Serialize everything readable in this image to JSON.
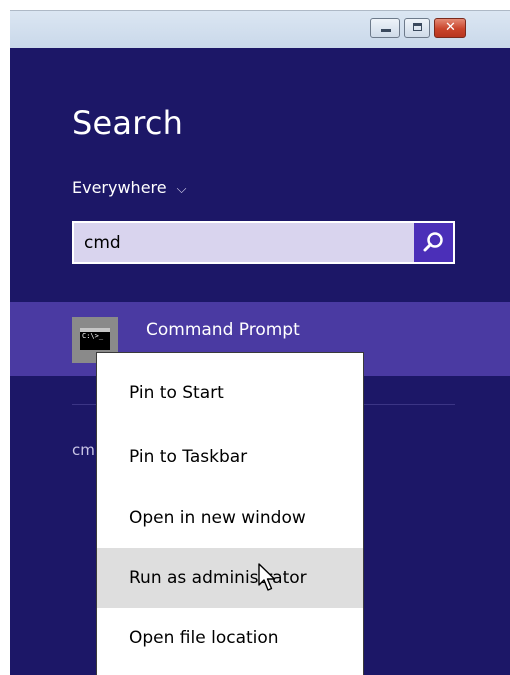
{
  "window": {
    "controls": [
      {
        "name": "minimize-icon"
      },
      {
        "name": "maximize-icon"
      },
      {
        "name": "close-icon",
        "glyph": "✕"
      }
    ]
  },
  "search_panel": {
    "title": "Search",
    "scope": {
      "label": "Everywhere",
      "chevron": "⌵"
    },
    "search_box": {
      "value": "cmd",
      "placeholder": ""
    },
    "results": [
      {
        "label": "Command Prompt",
        "icon": "command-prompt-icon",
        "icon_text": "C:\\>_",
        "selected": true
      },
      {
        "label": "cm",
        "truncated": true
      }
    ],
    "colors": {
      "background": "#1c1767",
      "selected_row": "#4a3aa2",
      "search_button": "#4b2fb8",
      "search_box": "#d9d4ee"
    }
  },
  "context_menu": {
    "items": [
      {
        "label": "Pin to Start"
      },
      {
        "label": "Pin to Taskbar"
      },
      {
        "label": "Open in new window"
      },
      {
        "label": "Run as administrator",
        "hovered": true
      },
      {
        "label": "Open file location"
      }
    ],
    "hover_color": "#dedede"
  },
  "cursor": {
    "icon": "arrow-cursor-icon"
  }
}
